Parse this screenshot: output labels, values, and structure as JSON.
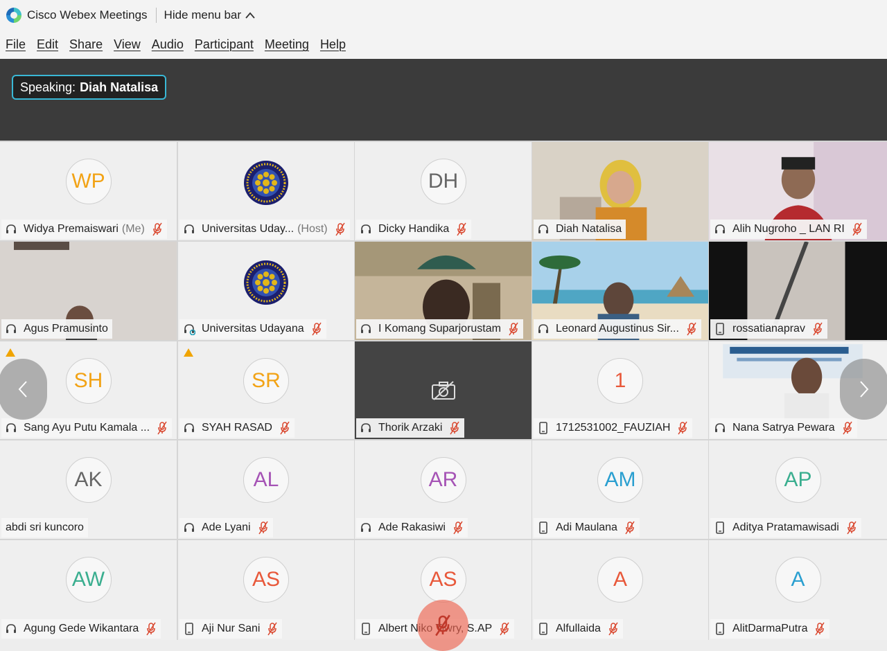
{
  "titlebar": {
    "app_title": "Cisco Webex Meetings",
    "hide_menu_label": "Hide menu bar"
  },
  "menu": [
    "File",
    "Edit",
    "Share",
    "View",
    "Audio",
    "Participant",
    "Meeting",
    "Help"
  ],
  "speaking": {
    "prefix": "Speaking:",
    "name": "Diah Natalisa"
  },
  "colors": {
    "active_border": "#2fb6de",
    "mute_icon": "#d9452c",
    "warning": "#f0a400"
  },
  "participants": [
    {
      "name": "Widya Premaiswari",
      "role": "(Me)",
      "initials": "WP",
      "initials_color": "#f2a316",
      "kind": "avatar",
      "device": "headset-icon",
      "muted": true
    },
    {
      "name": "Universitas Uday...",
      "role": "(Host)",
      "kind": "logo",
      "device": "headset-icon",
      "muted": true
    },
    {
      "name": "Dicky Handika",
      "initials": "DH",
      "initials_color": "#666666",
      "kind": "avatar",
      "device": "headset-icon",
      "muted": true
    },
    {
      "name": "Diah Natalisa",
      "kind": "video",
      "device": "headset-icon",
      "muted": false,
      "active": true
    },
    {
      "name": "Alih Nugroho _ LAN RI",
      "kind": "video",
      "device": "headset-icon",
      "muted": true
    },
    {
      "name": "Agus Pramusinto",
      "kind": "video",
      "device": "headset-icon",
      "muted": false
    },
    {
      "name": "Universitas Udayana",
      "kind": "logo",
      "device": "headset-active-icon",
      "muted": true
    },
    {
      "name": "I Komang Suparjorustam",
      "kind": "video",
      "device": "headset-icon",
      "muted": true
    },
    {
      "name": "Leonard Augustinus Sir...",
      "kind": "video",
      "device": "headset-icon",
      "muted": true
    },
    {
      "name": "rossatianaprav",
      "kind": "video",
      "device": "phone-icon",
      "muted": true
    },
    {
      "name": "Sang Ayu Putu Kamala ...",
      "initials": "SH",
      "initials_color": "#f2a316",
      "kind": "avatar",
      "device": "headset-icon",
      "muted": true,
      "warning": true
    },
    {
      "name": "SYAH RASAD",
      "initials": "SR",
      "initials_color": "#f2a316",
      "kind": "avatar",
      "device": "headset-icon",
      "muted": true,
      "warning": true
    },
    {
      "name": "Thorik Arzaki",
      "kind": "video-off",
      "device": "headset-icon",
      "muted": true
    },
    {
      "name": "1712531002_FAUZIAH",
      "initials": "1",
      "initials_color": "#e8583a",
      "kind": "avatar",
      "device": "phone-icon",
      "muted": true
    },
    {
      "name": "Nana Satrya Pewara",
      "kind": "video",
      "device": "headset-icon",
      "muted": true
    },
    {
      "name": "abdi sri kuncoro",
      "initials": "AK",
      "initials_color": "#666666",
      "kind": "avatar",
      "device": "none",
      "muted": false
    },
    {
      "name": "Ade Lyani",
      "initials": "AL",
      "initials_color": "#a553b5",
      "kind": "avatar",
      "device": "headset-icon",
      "muted": true
    },
    {
      "name": "Ade Rakasiwi",
      "initials": "AR",
      "initials_color": "#a553b5",
      "kind": "avatar",
      "device": "headset-icon",
      "muted": true
    },
    {
      "name": "Adi Maulana",
      "initials": "AM",
      "initials_color": "#2a9fd0",
      "kind": "avatar",
      "device": "phone-icon",
      "muted": true
    },
    {
      "name": "Aditya Pratamawisadi",
      "initials": "AP",
      "initials_color": "#3aae8f",
      "kind": "avatar",
      "device": "phone-icon",
      "muted": true
    },
    {
      "name": "Agung Gede Wikantara",
      "initials": "AW",
      "initials_color": "#3aae8f",
      "kind": "avatar",
      "device": "headset-icon",
      "muted": true
    },
    {
      "name": "Aji Nur Sani",
      "initials": "AS",
      "initials_color": "#e8583a",
      "kind": "avatar",
      "device": "phone-icon",
      "muted": true
    },
    {
      "name": "Albert Niko Tiwry, S.AP",
      "initials": "AS",
      "initials_color": "#e8583a",
      "kind": "avatar",
      "device": "phone-icon",
      "muted": true
    },
    {
      "name": "Alfullaida",
      "initials": "A",
      "initials_color": "#e8583a",
      "kind": "avatar",
      "device": "phone-icon",
      "muted": true
    },
    {
      "name": "AlitDarmaPutra",
      "initials": "A",
      "initials_color": "#2a9fd0",
      "kind": "avatar",
      "device": "phone-icon",
      "muted": true
    }
  ]
}
